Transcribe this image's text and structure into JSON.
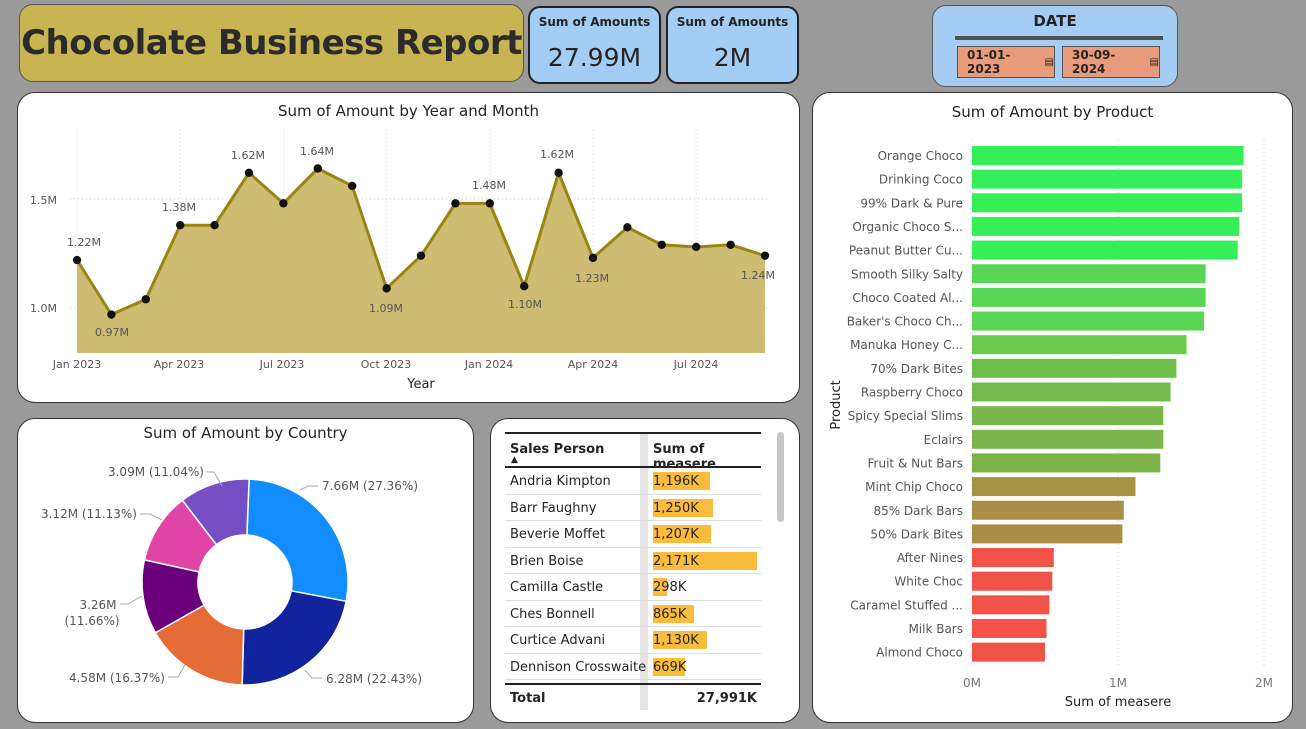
{
  "header": {
    "title": "Chocolate Business Report",
    "kpi1": {
      "label": "Sum of Amounts",
      "value": "27.99M"
    },
    "kpi2": {
      "label": "Sum of Amounts",
      "value": "2M"
    },
    "date": {
      "label": "DATE",
      "start": "01-01-2023",
      "end": "30-09-2024"
    }
  },
  "colors": {
    "title_bg": "#c9b452",
    "kpi_bg": "#a3cdf5",
    "area": "#cdbc72",
    "line": "#9a8512",
    "table_bar": "#fbbc3d"
  },
  "line_chart": {
    "title": "Sum of Amount by Year and Month",
    "xlabel": "Year",
    "x_ticks": [
      "Jan 2023",
      "Apr 2023",
      "Jul 2023",
      "Oct 2023",
      "Jan 2024",
      "Apr 2024",
      "Jul 2024"
    ],
    "y_ticks": [
      "1.0M",
      "1.5M"
    ],
    "point_labels": [
      "1.22M",
      "0.97M",
      "1.38M",
      "1.62M",
      "1.64M",
      "1.09M",
      "1.48M",
      "1.10M",
      "1.62M",
      "1.23M",
      "1.24M"
    ]
  },
  "donut_chart": {
    "title": "Sum of Amount by Country",
    "labels": [
      "7.66M (27.36%)",
      "6.28M (22.43%)",
      "4.58M (16.37%)",
      "3.26M",
      "(11.66%)",
      "3.12M (11.13%)",
      "3.09M (11.04%)"
    ]
  },
  "product_chart": {
    "title": "Sum of Amount by Product",
    "ylabel": "Product",
    "xlabel": "Sum of measere",
    "x_ticks": [
      "0M",
      "1M",
      "2M"
    ]
  },
  "table": {
    "col1": "Sales Person",
    "col2": "Sum of measere",
    "rows": [
      {
        "name": "Andria Kimpton",
        "value": "1,196K",
        "v": 1196
      },
      {
        "name": "Barr Faughny",
        "value": "1,250K",
        "v": 1250
      },
      {
        "name": "Beverie Moffet",
        "value": "1,207K",
        "v": 1207
      },
      {
        "name": "Brien Boise",
        "value": "2,171K",
        "v": 2171
      },
      {
        "name": "Camilla Castle",
        "value": "298K",
        "v": 298
      },
      {
        "name": "Ches Bonnell",
        "value": "865K",
        "v": 865
      },
      {
        "name": "Curtice Advani",
        "value": "1,130K",
        "v": 1130
      },
      {
        "name": "Dennison Crosswaite",
        "value": "669K",
        "v": 669
      }
    ],
    "total_label": "Total",
    "total_value": "27,991K"
  },
  "chart_data": [
    {
      "type": "area",
      "title": "Sum of Amount by Year and Month",
      "xlabel": "Year",
      "x": [
        "2023-01",
        "2023-02",
        "2023-03",
        "2023-04",
        "2023-05",
        "2023-06",
        "2023-07",
        "2023-08",
        "2023-09",
        "2023-10",
        "2023-11",
        "2023-12",
        "2024-01",
        "2024-02",
        "2024-03",
        "2024-04",
        "2024-05",
        "2024-06",
        "2024-07",
        "2024-08",
        "2024-09"
      ],
      "values": [
        1.22,
        0.97,
        1.04,
        1.38,
        1.38,
        1.62,
        1.48,
        1.64,
        1.56,
        1.09,
        1.24,
        1.48,
        1.48,
        1.1,
        1.62,
        1.23,
        1.37,
        1.29,
        1.28,
        1.29,
        1.24
      ],
      "unit": "M",
      "ylim": [
        0.8,
        1.8
      ],
      "grid": true
    },
    {
      "type": "pie",
      "title": "Sum of Amount by Country",
      "values": [
        7.66,
        6.28,
        4.58,
        3.26,
        3.12,
        3.09
      ],
      "percents": [
        27.36,
        22.43,
        16.37,
        11.66,
        11.13,
        11.04
      ],
      "colors": [
        "#118dff",
        "#12239e",
        "#e66c37",
        "#6b007b",
        "#e044a7",
        "#744ec2"
      ]
    },
    {
      "type": "bar",
      "orientation": "horizontal",
      "title": "Sum of Amount by Product",
      "ylabel": "Product",
      "xlabel": "Sum of measere",
      "categories": [
        "Orange Choco",
        "Drinking Coco",
        "99% Dark & Pure",
        "Organic Choco S...",
        "Peanut Butter Cu...",
        "Smooth Silky Salty",
        "Choco Coated Al...",
        "Baker's Choco Ch...",
        "Manuka Honey C...",
        "70% Dark Bites",
        "Raspberry Choco",
        "Spicy Special Slims",
        "Eclairs",
        "Fruit & Nut Bars",
        "Mint Chip Choco",
        "85% Dark Bars",
        "50% Dark Bites",
        "After Nines",
        "White Choc",
        "Caramel Stuffed ...",
        "Milk Bars",
        "Almond Choco"
      ],
      "values": [
        1.86,
        1.85,
        1.85,
        1.83,
        1.82,
        1.6,
        1.6,
        1.59,
        1.47,
        1.4,
        1.36,
        1.31,
        1.31,
        1.29,
        1.12,
        1.04,
        1.03,
        0.56,
        0.55,
        0.53,
        0.51,
        0.5
      ],
      "colors": [
        "#35ef58",
        "#35ef58",
        "#35ef58",
        "#35ef58",
        "#35ef58",
        "#57d553",
        "#57d553",
        "#57d553",
        "#6bc94c",
        "#6ec04d",
        "#74bb4c",
        "#79b74b",
        "#7bb54b",
        "#7db44a",
        "#a79443",
        "#a88e46",
        "#a88e46",
        "#f25348",
        "#f25348",
        "#f25348",
        "#f25348",
        "#f25348"
      ],
      "xlim": [
        0,
        2
      ],
      "unit": "M"
    }
  ]
}
